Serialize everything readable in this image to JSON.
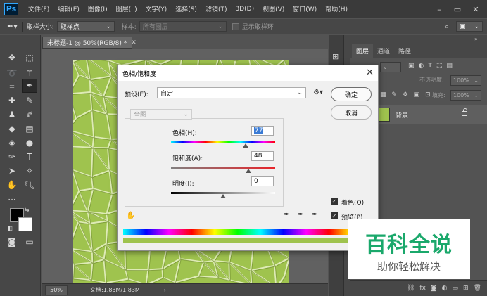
{
  "app": {
    "logo": "Ps",
    "menu": [
      "文件(F)",
      "编辑(E)",
      "图像(I)",
      "图层(L)",
      "文字(Y)",
      "选择(S)",
      "滤镜(T)",
      "3D(D)",
      "视图(V)",
      "窗口(W)",
      "帮助(H)"
    ]
  },
  "options": {
    "sample_size_label": "取样大小:",
    "sample_size_value": "取样点",
    "sample_label": "样本:",
    "sample_value": "所有图层",
    "show_ring_label": "显示取样环"
  },
  "document": {
    "tab_title": "未标题-1 @ 50%(RGB/8) *",
    "zoom": "50%",
    "doc_info": "文档:1.83M/1.83M"
  },
  "layers_panel": {
    "tabs": [
      "图层",
      "通道",
      "路径"
    ],
    "opacity_label": "不透明度:",
    "opacity_value": "100%",
    "fill_label": "填充:",
    "fill_value": "100%",
    "layer_name": "背景"
  },
  "dialog": {
    "title": "色相/饱和度",
    "preset_label": "预设(E):",
    "preset_value": "自定",
    "channel_value": "全图",
    "hue_label": "色相(H):",
    "hue_value": "77",
    "saturation_label": "饱和度(A):",
    "saturation_value": "48",
    "lightness_label": "明度(I):",
    "lightness_value": "0",
    "ok_label": "确定",
    "cancel_label": "取消",
    "colorize_label": "着色(O)",
    "preview_label": "预览(P)",
    "colorize_checked": true,
    "preview_checked": true
  },
  "watermark": {
    "title": "百科全说",
    "subtitle": "助你轻松解决"
  },
  "colors": {
    "texture_green": "#9fc34e",
    "watermark_green": "#1aa86b"
  }
}
